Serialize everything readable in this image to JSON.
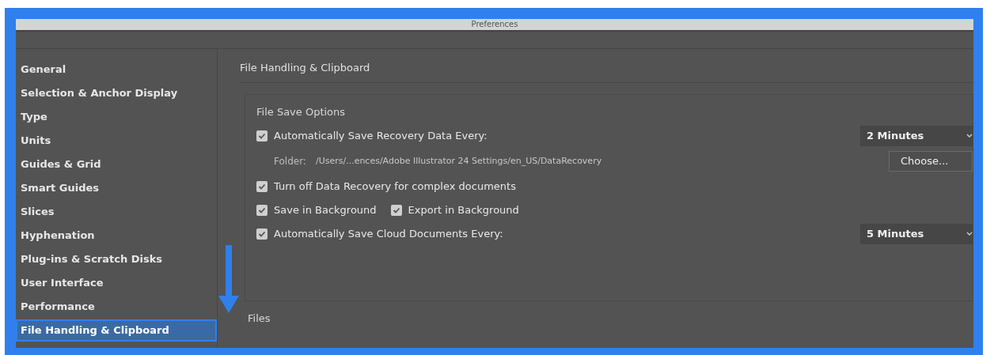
{
  "window": {
    "title": "Preferences"
  },
  "sidebar": {
    "items": [
      {
        "label": "General",
        "selected": false
      },
      {
        "label": "Selection & Anchor Display",
        "selected": false
      },
      {
        "label": "Type",
        "selected": false
      },
      {
        "label": "Units",
        "selected": false
      },
      {
        "label": "Guides & Grid",
        "selected": false
      },
      {
        "label": "Smart Guides",
        "selected": false
      },
      {
        "label": "Slices",
        "selected": false
      },
      {
        "label": "Hyphenation",
        "selected": false
      },
      {
        "label": "Plug-ins & Scratch Disks",
        "selected": false
      },
      {
        "label": "User Interface",
        "selected": false
      },
      {
        "label": "Performance",
        "selected": false
      },
      {
        "label": "File Handling & Clipboard",
        "selected": true
      }
    ]
  },
  "panel": {
    "title": "File Handling & Clipboard",
    "group": {
      "title": "File Save Options",
      "rows": [
        {
          "kind": "checkbox",
          "label": "Automatically Save Recovery Data Every:",
          "checked": true,
          "dropdown": "2 Minutes"
        },
        {
          "kind": "folder",
          "label": "Folder:",
          "path": "/Users/...ences/Adobe Illustrator 24 Settings/en_US/DataRecovery",
          "button": "Choose..."
        },
        {
          "kind": "checkbox",
          "label": "Turn off Data Recovery for complex documents",
          "checked": true
        },
        {
          "kind": "pair",
          "items": [
            {
              "label": "Save in Background",
              "checked": true
            },
            {
              "label": "Export in Background",
              "checked": true
            }
          ]
        },
        {
          "kind": "checkbox",
          "label": "Automatically Save Cloud Documents Every:",
          "checked": true,
          "dropdown": "5 Minutes"
        }
      ]
    },
    "next_section": "Files"
  }
}
